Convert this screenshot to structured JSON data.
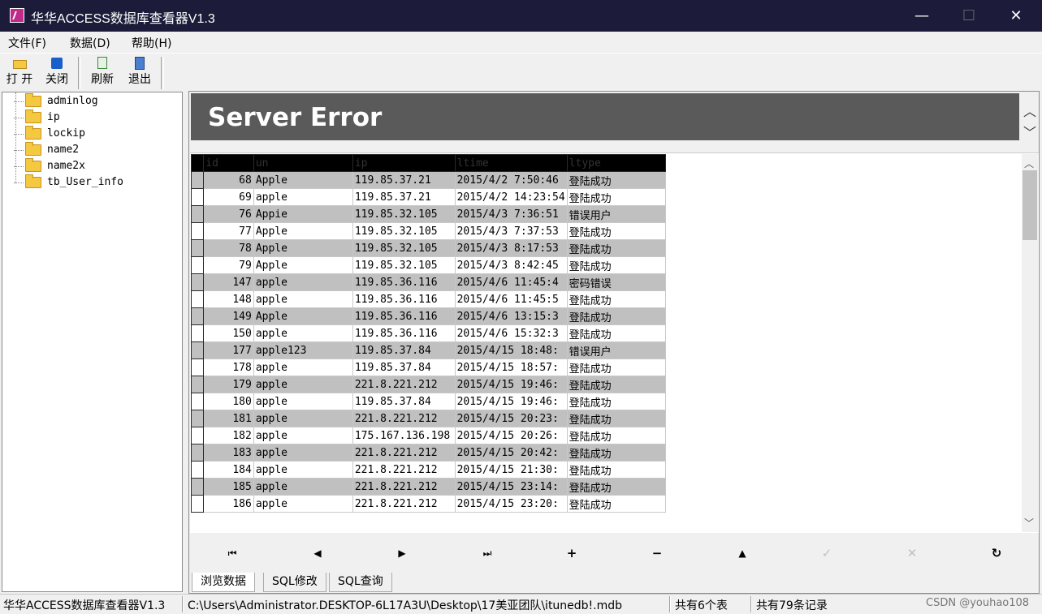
{
  "window": {
    "title": "华华ACCESS数据库查看器V1.3",
    "minimize": "—",
    "maximize": "☐",
    "close": "✕"
  },
  "menu": {
    "file": "文件(F)",
    "data": "数据(D)",
    "help": "帮助(H)"
  },
  "toolbar": {
    "open": "打 开",
    "close": "关闭",
    "refresh": "刷新",
    "exit": "退出"
  },
  "tree": {
    "items": [
      "adminlog",
      "ip",
      "lockip",
      "name2",
      "name2x",
      "tb_User_info"
    ]
  },
  "error_banner": {
    "text": "Server Error"
  },
  "grid": {
    "columns": [
      "id",
      "un",
      "ip",
      "ltime",
      "ltype"
    ],
    "rows": [
      [
        "68",
        "Apple",
        "119.85.37.21",
        "2015/4/2 7:50:46",
        "登陆成功"
      ],
      [
        "69",
        "apple",
        "119.85.37.21",
        "2015/4/2 14:23:54",
        "登陆成功"
      ],
      [
        "76",
        "Appie",
        "119.85.32.105",
        "2015/4/3 7:36:51",
        "错误用户"
      ],
      [
        "77",
        "Apple",
        "119.85.32.105",
        "2015/4/3 7:37:53",
        "登陆成功"
      ],
      [
        "78",
        "Apple",
        "119.85.32.105",
        "2015/4/3 8:17:53",
        "登陆成功"
      ],
      [
        "79",
        "Apple",
        "119.85.32.105",
        "2015/4/3 8:42:45",
        "登陆成功"
      ],
      [
        "147",
        "apple",
        "119.85.36.116",
        "2015/4/6 11:45:4",
        "密码错误"
      ],
      [
        "148",
        "apple",
        "119.85.36.116",
        "2015/4/6 11:45:5",
        "登陆成功"
      ],
      [
        "149",
        "Apple",
        "119.85.36.116",
        "2015/4/6 13:15:3",
        "登陆成功"
      ],
      [
        "150",
        "apple",
        "119.85.36.116",
        "2015/4/6 15:32:3",
        "登陆成功"
      ],
      [
        "177",
        "apple123",
        "119.85.37.84",
        "2015/4/15 18:48:",
        "错误用户"
      ],
      [
        "178",
        "apple",
        "119.85.37.84",
        "2015/4/15 18:57:",
        "登陆成功"
      ],
      [
        "179",
        "apple",
        "221.8.221.212",
        "2015/4/15 19:46:",
        "登陆成功"
      ],
      [
        "180",
        "apple",
        "119.85.37.84",
        "2015/4/15 19:46:",
        "登陆成功"
      ],
      [
        "181",
        "apple",
        "221.8.221.212",
        "2015/4/15 20:23:",
        "登陆成功"
      ],
      [
        "182",
        "apple",
        "175.167.136.198",
        "2015/4/15 20:26:",
        "登陆成功"
      ],
      [
        "183",
        "apple",
        "221.8.221.212",
        "2015/4/15 20:42:",
        "登陆成功"
      ],
      [
        "184",
        "apple",
        "221.8.221.212",
        "2015/4/15 21:30:",
        "登陆成功"
      ],
      [
        "185",
        "apple",
        "221.8.221.212",
        "2015/4/15 23:14:",
        "登陆成功"
      ],
      [
        "186",
        "apple",
        "221.8.221.212",
        "2015/4/15 23:20:",
        "登陆成功"
      ]
    ]
  },
  "navigator": {
    "first": "⏮",
    "prior": "◀",
    "next": "▶",
    "last": "⏭",
    "insert": "+",
    "delete": "−",
    "edit": "▲",
    "post": "✓",
    "cancel": "✕",
    "refresh": "↻"
  },
  "tabs": [
    "浏览数据",
    "SQL修改",
    "SQL查询"
  ],
  "status": {
    "app": "华华ACCESS数据库查看器V1.3",
    "path": "C:\\Users\\Administrator.DESKTOP-6L17A3U\\Desktop\\17美亚团队\\itunedb!.mdb",
    "tables": "共有6个表",
    "records": "共有79条记录",
    "watermark": "CSDN @youhao108"
  },
  "colors": {
    "titlebar": "#1c1c3a",
    "error_banner": "#5a5a5a",
    "row_alt": "#c0c0c0"
  }
}
